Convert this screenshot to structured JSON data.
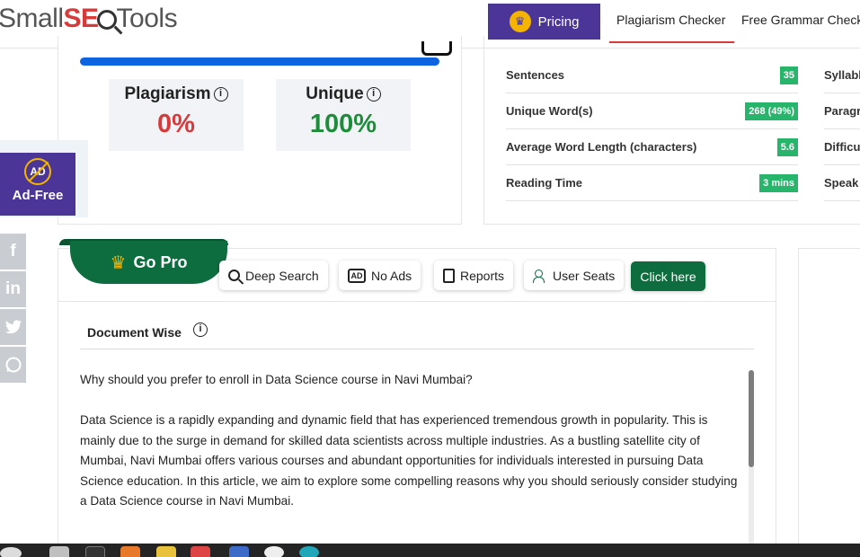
{
  "header": {
    "logo_small": "Small",
    "logo_seo": "SE",
    "logo_tools": "Tools",
    "pricing_label": "Pricing",
    "nav": [
      "Plagiarism Checker",
      "Free Grammar Check"
    ]
  },
  "results": {
    "progress_fraction": 1.0,
    "plagiarism_label": "Plagiarism",
    "plagiarism_value": "0%",
    "unique_label": "Unique",
    "unique_value": "100%"
  },
  "stats": [
    {
      "label": "Sentences",
      "value": "35"
    },
    {
      "label": "Unique Word(s)",
      "value": "268 (49%)"
    },
    {
      "label": "Average Word Length (characters)",
      "value": "5.6"
    },
    {
      "label": "Reading Time",
      "value": "3 mins"
    }
  ],
  "stats_right": [
    "Syllabl",
    "Paragr",
    "Difficul",
    "Speak"
  ],
  "adfree": {
    "icon_text": "AD",
    "label": "Ad-Free"
  },
  "social": [
    "f",
    "in",
    "twitter",
    "whatsapp"
  ],
  "pro": {
    "gopro_label": "Go Pro",
    "features": [
      "Deep Search",
      "No Ads",
      "Reports",
      "User Seats"
    ],
    "no_ads_icon_text": "AD",
    "cta_label": "Click here"
  },
  "document": {
    "section_title": "Document Wise",
    "paragraphs": [
      "Why should you prefer to enroll in Data Science course in Navi Mumbai?",
      "Data Science is a rapidly expanding and dynamic field that has experienced tremendous growth in popularity. This is mainly due to the surge in demand for skilled data scientists across multiple industries. As a bustling satellite city of Mumbai, Navi Mumbai offers various courses and abundant opportunities for individuals interested in pursuing Data Science education. In this article, we aim to explore some compelling reasons why you should seriously consider studying a Data Science course in Navi Mumbai."
    ]
  },
  "colors": {
    "brand_purple": "#4b3596",
    "progress_blue": "#0d63e0",
    "plagiarism_red": "#d63a3a",
    "unique_green": "#1e8c3a",
    "badge_green": "#27b56c",
    "pro_green": "#0e6d3e",
    "crown_gold": "#f4b400"
  }
}
